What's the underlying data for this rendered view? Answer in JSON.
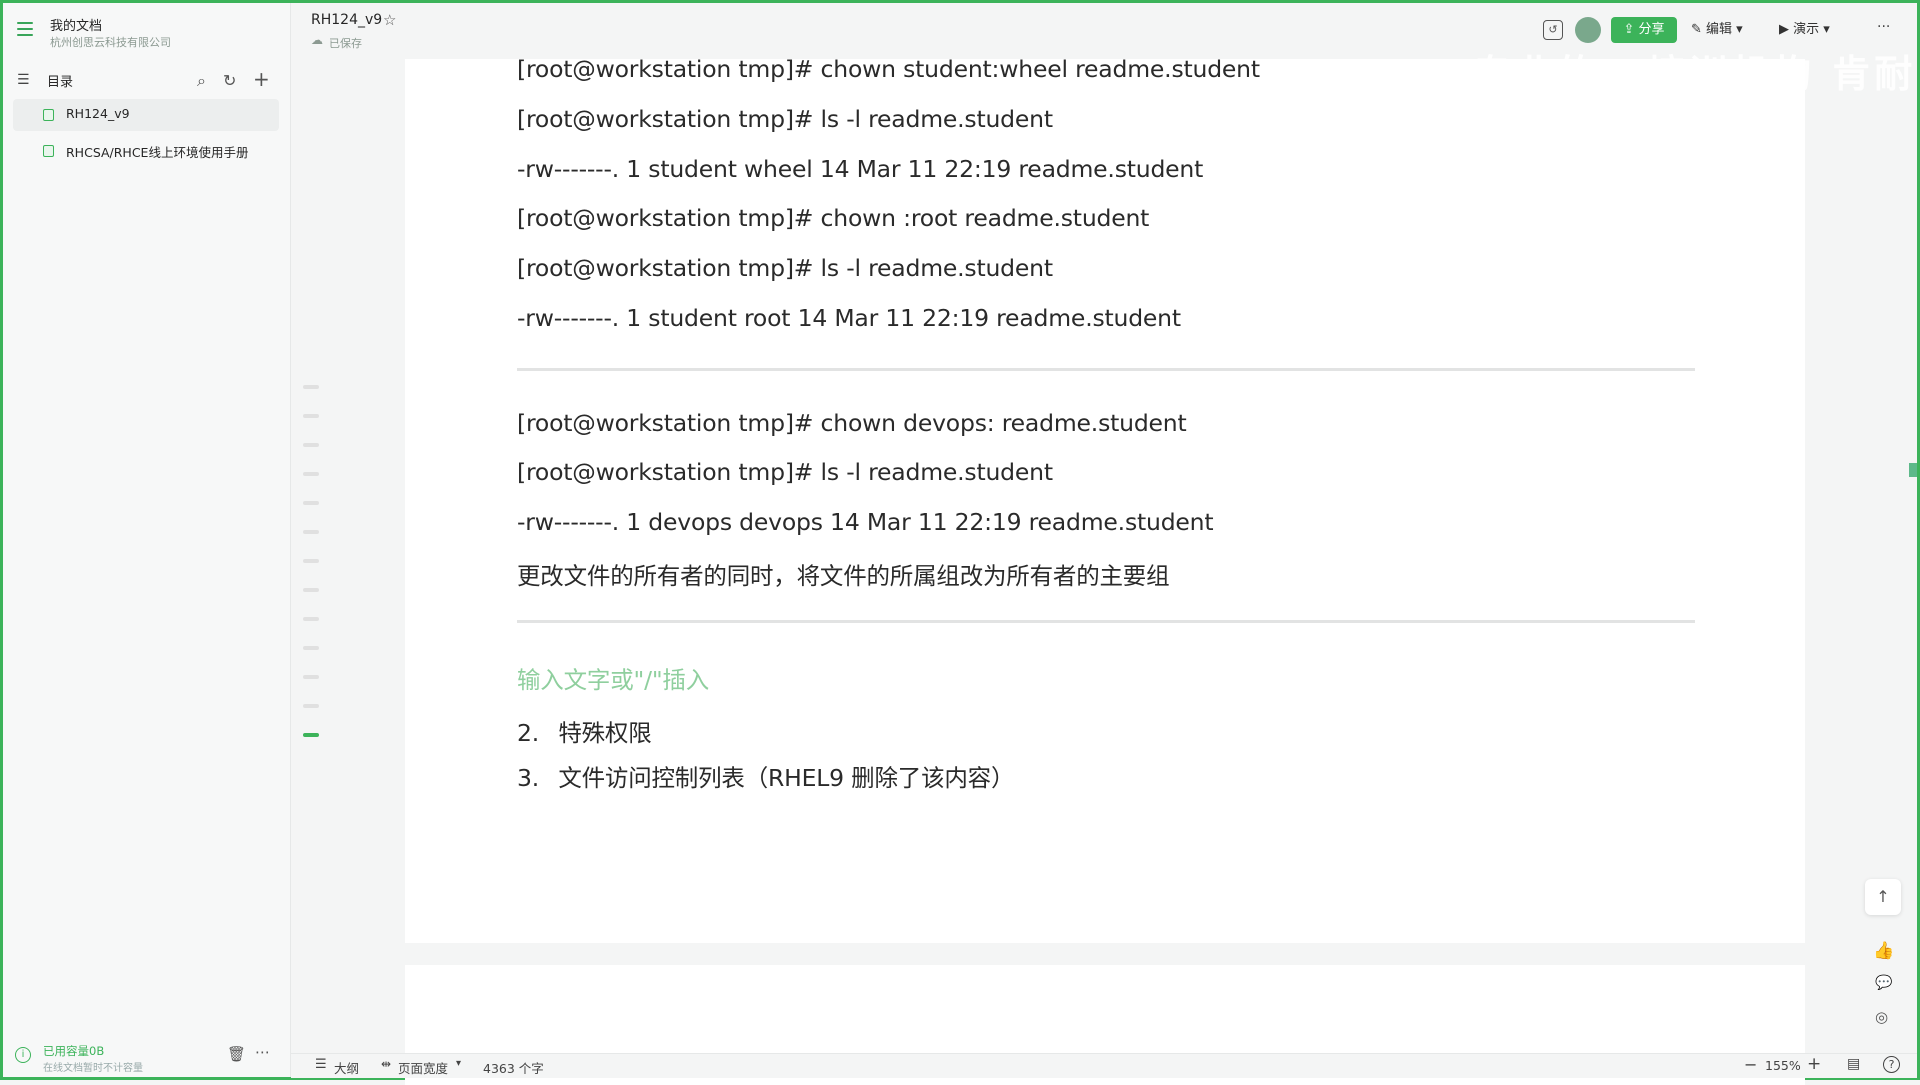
{
  "sidebar": {
    "owner": "我的文档",
    "org": "杭州创思云科技有限公司",
    "toc_label": "目录",
    "items": [
      {
        "label": "RH124_v9"
      },
      {
        "label": "RHCSA/RHCE线上环境使用手册"
      }
    ],
    "storage_used": "已用容量0B",
    "storage_note": "在线文档暂时不计容量"
  },
  "header": {
    "title": "RH124_v9",
    "saved": "已保存",
    "share_label": "分享",
    "edit_label": "编辑",
    "present_label": "演示",
    "more_label": "···"
  },
  "content": {
    "lines": [
      "[root@workstation tmp]# chown student:wheel readme.student",
      "[root@workstation tmp]# ls -l readme.student",
      "-rw-------. 1 student wheel 14 Mar 11 22:19 readme.student",
      "[root@workstation tmp]# chown :root readme.student",
      "[root@workstation tmp]# ls -l readme.student",
      "-rw-------. 1 student root 14 Mar 11 22:19 readme.student"
    ],
    "lines2": [
      "[root@workstation tmp]# chown devops: readme.student",
      "[root@workstation tmp]# ls -l readme.student",
      "-rw-------. 1 devops devops 14 Mar 11 22:19 readme.student",
      "更改文件的所有者的同时，将文件的所属组改为所有者的主要组"
    ],
    "placeholder": "输入文字或\"/\"插入",
    "list": [
      {
        "num": "2.",
        "text": "特殊权限"
      },
      {
        "num": "3.",
        "text": "文件访问控制列表（RHEL9 删除了该内容）"
      }
    ]
  },
  "footer": {
    "outline_label": "大纲",
    "width_label": "页面宽度",
    "word_count": "4363 个字",
    "zoom": "155%"
  },
  "watermark": "专业的IT培训机构 肯耐博"
}
